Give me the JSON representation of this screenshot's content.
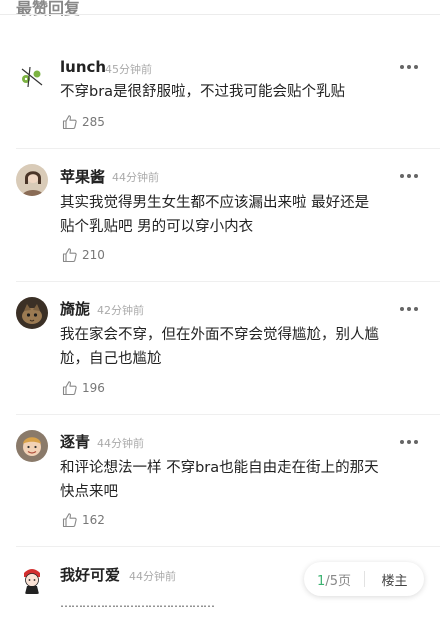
{
  "section": {
    "title": "最赞回复"
  },
  "comments": [
    {
      "name": "lunch",
      "time": "45分钟前",
      "text": [
        "不穿bra是很舒服啦，不过我可能会贴个乳贴"
      ],
      "likes": "285",
      "avatar": "stick-figure-avatar"
    },
    {
      "name": "苹果酱",
      "time": "44分钟前",
      "text": [
        "其实我觉得男生女生都不应该漏出来啦 最好还是",
        "贴个乳贴吧 男的可以穿小内衣"
      ],
      "likes": "210",
      "avatar": "girl-photo-avatar"
    },
    {
      "name": "旖旎",
      "time": "42分钟前",
      "text": [
        "我在家会不穿，但在外面不穿会觉得尴尬，别人尴",
        "尬，自己也尴尬"
      ],
      "likes": "196",
      "avatar": "cat-photo-avatar"
    },
    {
      "name": "逐青",
      "time": "44分钟前",
      "text": [
        "和评论想法一样 不穿bra也能自由走在街上的那天",
        "快点来吧"
      ],
      "likes": "162",
      "avatar": "boy-photo-avatar"
    },
    {
      "name": "我好可爱",
      "time": "44分钟前",
      "text": [
        "……………………………………"
      ],
      "likes": "",
      "avatar": "cartoon-girl-avatar"
    }
  ],
  "pager": {
    "current": "1",
    "total": "/5页",
    "floor_owner": "楼主"
  },
  "colors": {
    "accent": "#3cb371",
    "muted": "#aaaaaa"
  }
}
